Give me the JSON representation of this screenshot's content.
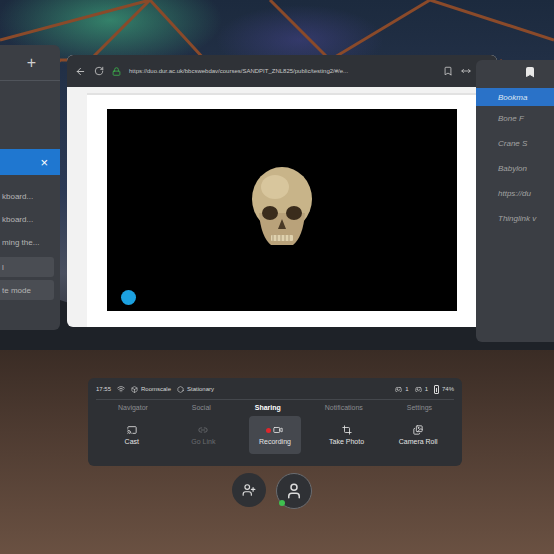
{
  "left_panel": {
    "add": "+",
    "close": "×",
    "rows": [
      {
        "label": "kboard...",
        "kind": "link"
      },
      {
        "label": "kboard...",
        "kind": "link"
      },
      {
        "label": "ming the...",
        "kind": "link"
      },
      {
        "label": "l",
        "kind": "button"
      },
      {
        "label": "te mode",
        "kind": "button"
      }
    ]
  },
  "browser": {
    "url": "https://duo.dur.ac.uk/bbcswebdav/courses/SANDPIT_ZNL825/public/testing2/#/e...",
    "secure": true
  },
  "bookmarks": {
    "title": "Bookma",
    "items": [
      "Bone F",
      "Crane S",
      "Babylon",
      "https://du",
      "Thinglink v"
    ]
  },
  "menu": {
    "status": {
      "time": "17:55",
      "modes": [
        "Roomscale",
        "Stationary"
      ],
      "counts": [
        "1",
        "1"
      ],
      "battery": "74%",
      "battery_level": 0.74
    },
    "tabs": [
      {
        "label": "Navigator",
        "selected": false
      },
      {
        "label": "Social",
        "selected": false
      },
      {
        "label": "Sharing",
        "selected": true
      },
      {
        "label": "Notifications",
        "selected": false
      },
      {
        "label": "Settings",
        "selected": false
      }
    ],
    "actions": [
      {
        "label": "Cast",
        "selected": false,
        "disabled": false
      },
      {
        "label": "Go Link",
        "selected": false,
        "disabled": true
      },
      {
        "label": "Recording",
        "selected": true,
        "disabled": false
      },
      {
        "label": "Take Photo",
        "selected": false,
        "disabled": false
      },
      {
        "label": "Camera Roll",
        "selected": false,
        "disabled": false
      }
    ]
  }
}
